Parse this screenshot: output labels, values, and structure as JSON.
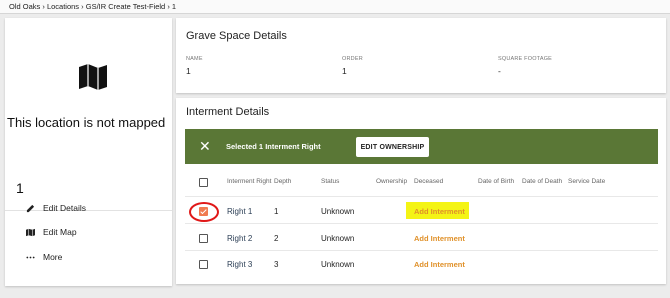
{
  "breadcrumb": {
    "items": [
      "Old Oaks",
      "Locations",
      "GS/IR Create Test-Field",
      "1"
    ],
    "separator": "›"
  },
  "location": {
    "map_icon": "map-icon",
    "not_mapped_text": "This location is not mapped",
    "number": "1",
    "actions": [
      {
        "label": "Edit Details",
        "icon": "pencil-icon"
      },
      {
        "label": "Edit Map",
        "icon": "map-icon"
      },
      {
        "label": "More",
        "icon": "more-horizontal-icon"
      }
    ]
  },
  "grave_space": {
    "title": "Grave Space Details",
    "fields": [
      {
        "label": "NAME",
        "value": "1"
      },
      {
        "label": "ORDER",
        "value": "1"
      },
      {
        "label": "SQUARE FOOTAGE",
        "value": "-"
      }
    ]
  },
  "interment": {
    "title": "Interment Details",
    "selection_bar": {
      "close_icon": "close-icon",
      "text": "Selected 1 Interment Right",
      "button_label": "EDIT OWNERSHIP",
      "color": "#5a7736"
    },
    "columns": [
      "Interment Right",
      "Depth",
      "Status",
      "Ownership",
      "Deceased",
      "Date of Birth",
      "Date of Death",
      "Service Date"
    ],
    "rows": [
      {
        "name": "Right 1",
        "depth": "1",
        "status": "Unknown",
        "action": "Add Interment",
        "checked": true
      },
      {
        "name": "Right 2",
        "depth": "2",
        "status": "Unknown",
        "action": "Add Interment",
        "checked": false
      },
      {
        "name": "Right 3",
        "depth": "3",
        "status": "Unknown",
        "action": "Add Interment",
        "checked": false
      }
    ],
    "accent_color": "#e0912a"
  }
}
